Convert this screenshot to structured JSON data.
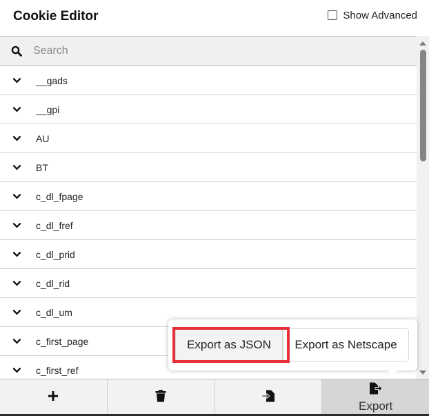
{
  "header": {
    "title": "Cookie Editor",
    "show_advanced_label": "Show Advanced",
    "show_advanced_checked": false
  },
  "search": {
    "placeholder": "Search",
    "value": ""
  },
  "cookies": [
    {
      "name": "__gads"
    },
    {
      "name": "__gpi"
    },
    {
      "name": "AU"
    },
    {
      "name": "BT"
    },
    {
      "name": "c_dl_fpage"
    },
    {
      "name": "c_dl_fref"
    },
    {
      "name": "c_dl_prid"
    },
    {
      "name": "c_dl_rid"
    },
    {
      "name": "c_dl_um"
    },
    {
      "name": "c_first_page"
    },
    {
      "name": "c_first_ref"
    }
  ],
  "export_menu": {
    "json_label": "Export as JSON",
    "netscape_label": "Export as Netscape",
    "highlighted": "json",
    "highlight_color": "#e8303a"
  },
  "footer": {
    "add_icon": "plus-icon",
    "delete_icon": "trash-icon",
    "import_icon": "import-icon",
    "export_icon": "file-export-icon",
    "export_label": "Export",
    "active": "export"
  }
}
